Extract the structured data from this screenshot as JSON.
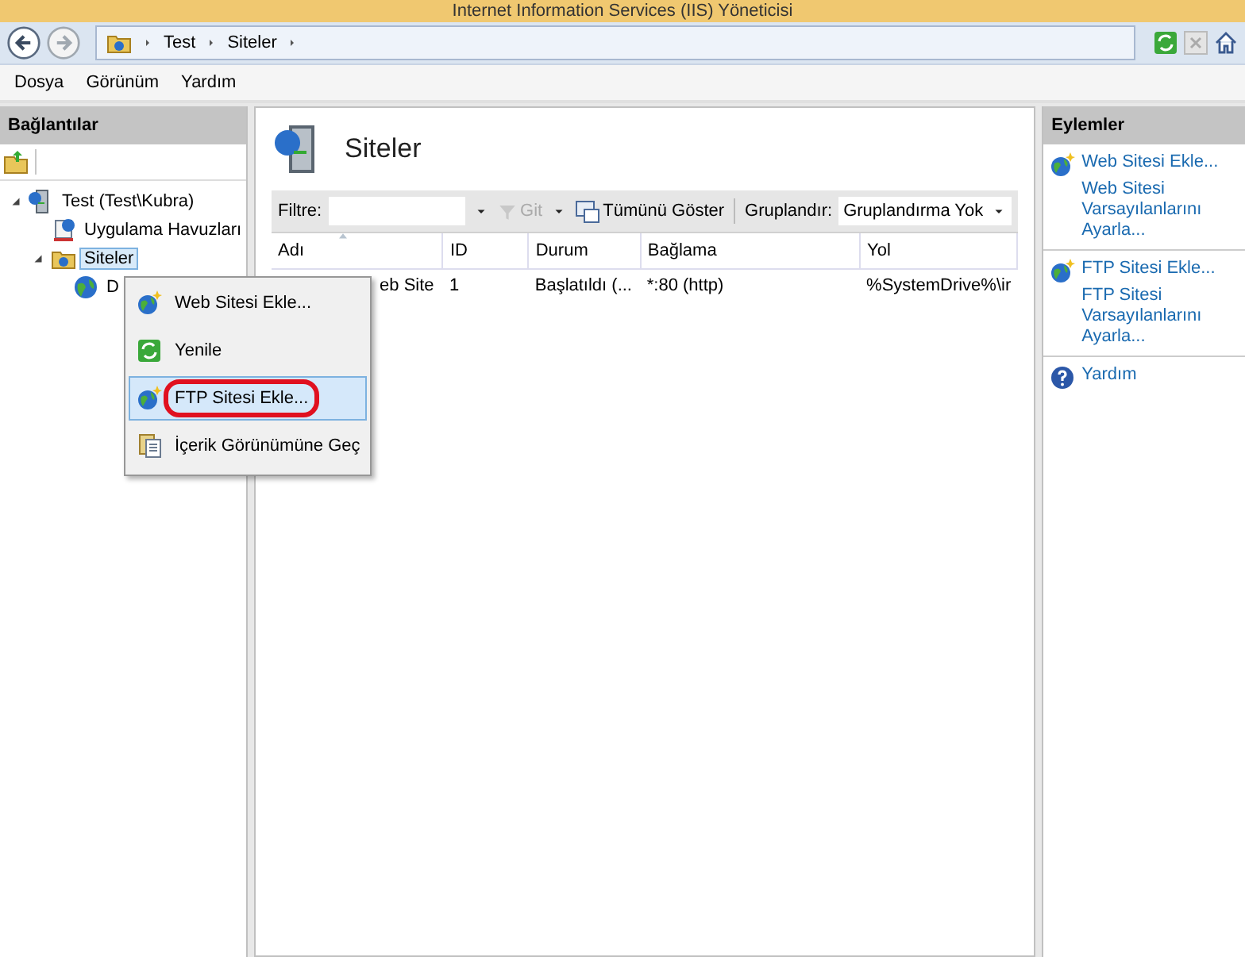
{
  "window": {
    "title": "Internet Information Services (IIS) Yöneticisi"
  },
  "address_bar": {
    "breadcrumbs": [
      "Test",
      "Siteler"
    ]
  },
  "menu_bar": [
    "Dosya",
    "Görünüm",
    "Yardım"
  ],
  "connections": {
    "title": "Bağlantılar",
    "tree": [
      {
        "label": "Test (Test\\Kubra)",
        "kind": "server",
        "expanded": true,
        "selected": false,
        "children": [
          {
            "label": "Uygulama Havuzları",
            "kind": "pools",
            "selected": false
          },
          {
            "label": "Siteler",
            "kind": "sites",
            "expanded": true,
            "selected": true,
            "children": [
              {
                "label": "D",
                "kind": "site",
                "selected": false
              }
            ]
          }
        ]
      }
    ]
  },
  "content": {
    "title": "Siteler",
    "filter": {
      "label": "Filtre:",
      "go": "Git",
      "show_all": "Tümünü Göster",
      "group_label": "Gruplandır:",
      "group_value": "Gruplandırma Yok"
    },
    "table": {
      "columns": [
        {
          "label": "Adı",
          "sorted": true
        },
        {
          "label": "ID",
          "sorted": false
        },
        {
          "label": "Durum",
          "sorted": false
        },
        {
          "label": "Bağlama",
          "sorted": false
        },
        {
          "label": "Yol",
          "sorted": false
        }
      ],
      "rows": [
        [
          "eb Site",
          "1",
          "Başlatıldı (...",
          "*:80 (http)",
          "%SystemDrive%\\ir"
        ]
      ]
    }
  },
  "actions": {
    "title": "Eylemler",
    "groups": [
      [
        {
          "label": "Web Sitesi Ekle...",
          "kind": "globe"
        },
        {
          "label": "Web Sitesi Varsayılanlarını Ayarla...",
          "kind": "plain"
        }
      ],
      [
        {
          "label": "FTP Sitesi Ekle...",
          "kind": "globe"
        },
        {
          "label": "FTP Sitesi Varsayılanlarını Ayarla...",
          "kind": "plain"
        }
      ],
      [
        {
          "label": "Yardım",
          "kind": "help"
        }
      ]
    ]
  },
  "context_menu": [
    {
      "label": "Web Sitesi Ekle...",
      "kind": "globe",
      "selected": false,
      "highlighted": false
    },
    {
      "label": "Yenile",
      "kind": "refresh",
      "selected": false,
      "highlighted": false
    },
    {
      "label": "FTP Sitesi Ekle...",
      "kind": "globe",
      "selected": true,
      "highlighted": true
    },
    {
      "label": "İçerik Görünümüne Geç",
      "kind": "content",
      "selected": false,
      "highlighted": false
    }
  ]
}
